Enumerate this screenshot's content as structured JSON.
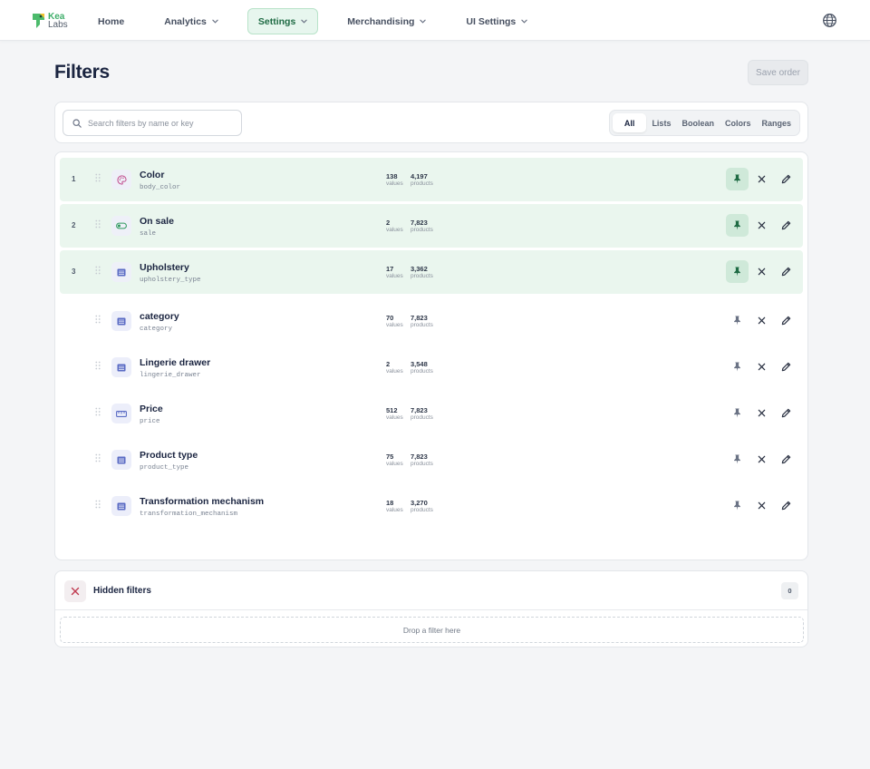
{
  "brand": {
    "name_top": "Kea",
    "name_bottom": "Labs",
    "logo_icon": "parrot-logo"
  },
  "nav": {
    "items": [
      {
        "label": "Home",
        "has_dropdown": false,
        "active": false
      },
      {
        "label": "Analytics",
        "has_dropdown": true,
        "active": false
      },
      {
        "label": "Settings",
        "has_dropdown": true,
        "active": true
      },
      {
        "label": "Merchandising",
        "has_dropdown": true,
        "active": false
      },
      {
        "label": "UI Settings",
        "has_dropdown": true,
        "active": false
      }
    ],
    "language_icon": "globe-icon"
  },
  "page": {
    "title": "Filters",
    "save_label": "Save order"
  },
  "search": {
    "placeholder": "Search filters by name or key",
    "value": ""
  },
  "tabs": [
    {
      "label": "All",
      "active": true
    },
    {
      "label": "Lists",
      "active": false
    },
    {
      "label": "Boolean",
      "active": false
    },
    {
      "label": "Colors",
      "active": false
    },
    {
      "label": "Ranges",
      "active": false
    }
  ],
  "filters": [
    {
      "position": "1",
      "name": "Color",
      "key": "body_color",
      "type_icon": "palette-icon",
      "values": "138",
      "products": "4,197",
      "pinned": true
    },
    {
      "position": "2",
      "name": "On sale",
      "key": "sale",
      "type_icon": "toggle-icon",
      "values": "2",
      "products": "7,823",
      "pinned": true
    },
    {
      "position": "3",
      "name": "Upholstery",
      "key": "upholstery_type",
      "type_icon": "list-icon",
      "values": "17",
      "products": "3,362",
      "pinned": true
    },
    {
      "position": "",
      "name": "category",
      "key": "category",
      "type_icon": "list-icon",
      "values": "70",
      "products": "7,823",
      "pinned": false
    },
    {
      "position": "",
      "name": "Lingerie drawer",
      "key": "lingerie_drawer",
      "type_icon": "list-icon",
      "values": "2",
      "products": "3,548",
      "pinned": false
    },
    {
      "position": "",
      "name": "Price",
      "key": "price",
      "type_icon": "range-icon",
      "values": "512",
      "products": "7,823",
      "pinned": false
    },
    {
      "position": "",
      "name": "Product type",
      "key": "product_type",
      "type_icon": "list-icon",
      "values": "75",
      "products": "7,823",
      "pinned": false
    },
    {
      "position": "",
      "name": "Transformation mechanism",
      "key": "transformation_mechanism",
      "type_icon": "list-icon",
      "values": "18",
      "products": "3,270",
      "pinned": false
    }
  ],
  "stat_labels": {
    "values": "values",
    "products": "products"
  },
  "hidden": {
    "title": "Hidden filters",
    "count": "0",
    "drop_label": "Drop a filter here"
  },
  "colors": {
    "accent": "#3fae6a",
    "pinned_row": "#eaf6ee",
    "pin_active": "#1f6b44",
    "pin_inactive": "#6b7385"
  }
}
